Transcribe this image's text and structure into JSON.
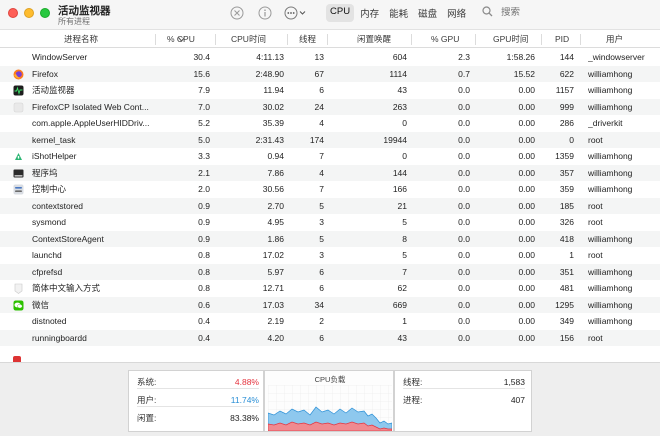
{
  "window": {
    "title": "活动监视器",
    "subtitle": "所有进程"
  },
  "toolbar": {
    "stop_icon": "stop-process-icon",
    "info_icon": "info-icon",
    "more_icon": "more-actions-icon",
    "tabs": [
      {
        "label": "CPU",
        "active": true
      },
      {
        "label": "内存",
        "active": false
      },
      {
        "label": "能耗",
        "active": false
      },
      {
        "label": "磁盘",
        "active": false
      },
      {
        "label": "网络",
        "active": false
      }
    ],
    "search_placeholder": "搜索"
  },
  "columns": [
    "进程名称",
    "% CPU",
    "CPU时间",
    "线程",
    "闲置唤醒",
    "% GPU",
    "GPU时间",
    "PID",
    "用户"
  ],
  "sorted_column": "% CPU",
  "processes": [
    {
      "name": "WindowServer",
      "cpu": "30.4",
      "cpu_time": "4:11.13",
      "threads": "13",
      "idle_wake": "604",
      "gpu": "2.3",
      "gpu_time": "1:58.26",
      "pid": "144",
      "user": "_windowserver",
      "icon": "none"
    },
    {
      "name": "Firefox",
      "cpu": "15.6",
      "cpu_time": "2:48.90",
      "threads": "67",
      "idle_wake": "1114",
      "gpu": "0.7",
      "gpu_time": "15.52",
      "pid": "622",
      "user": "williamhong",
      "icon": "firefox-icon"
    },
    {
      "name": "活动监视器",
      "cpu": "7.9",
      "cpu_time": "11.94",
      "threads": "6",
      "idle_wake": "43",
      "gpu": "0.0",
      "gpu_time": "0.00",
      "pid": "1157",
      "user": "williamhong",
      "icon": "activity-monitor-icon"
    },
    {
      "name": "FirefoxCP Isolated Web Cont...",
      "cpu": "7.0",
      "cpu_time": "30.02",
      "threads": "24",
      "idle_wake": "263",
      "gpu": "0.0",
      "gpu_time": "0.00",
      "pid": "999",
      "user": "williamhong",
      "icon": "generic-process-icon"
    },
    {
      "name": "com.apple.AppleUserHIDDriv...",
      "cpu": "5.2",
      "cpu_time": "35.39",
      "threads": "4",
      "idle_wake": "0",
      "gpu": "0.0",
      "gpu_time": "0.00",
      "pid": "286",
      "user": "_driverkit",
      "icon": "none"
    },
    {
      "name": "kernel_task",
      "cpu": "5.0",
      "cpu_time": "2:31.43",
      "threads": "174",
      "idle_wake": "19944",
      "gpu": "0.0",
      "gpu_time": "0.00",
      "pid": "0",
      "user": "root",
      "icon": "none"
    },
    {
      "name": "iShotHelper",
      "cpu": "3.3",
      "cpu_time": "0.94",
      "threads": "7",
      "idle_wake": "0",
      "gpu": "0.0",
      "gpu_time": "0.00",
      "pid": "1359",
      "user": "williamhong",
      "icon": "ishot-icon"
    },
    {
      "name": "程序坞",
      "cpu": "2.1",
      "cpu_time": "7.86",
      "threads": "4",
      "idle_wake": "144",
      "gpu": "0.0",
      "gpu_time": "0.00",
      "pid": "357",
      "user": "williamhong",
      "icon": "dock-icon"
    },
    {
      "name": "控制中心",
      "cpu": "2.0",
      "cpu_time": "30.56",
      "threads": "7",
      "idle_wake": "166",
      "gpu": "0.0",
      "gpu_time": "0.00",
      "pid": "359",
      "user": "williamhong",
      "icon": "control-center-icon"
    },
    {
      "name": "contextstored",
      "cpu": "0.9",
      "cpu_time": "2.70",
      "threads": "5",
      "idle_wake": "21",
      "gpu": "0.0",
      "gpu_time": "0.00",
      "pid": "185",
      "user": "root",
      "icon": "none"
    },
    {
      "name": "sysmond",
      "cpu": "0.9",
      "cpu_time": "4.95",
      "threads": "3",
      "idle_wake": "5",
      "gpu": "0.0",
      "gpu_time": "0.00",
      "pid": "326",
      "user": "root",
      "icon": "none"
    },
    {
      "name": "ContextStoreAgent",
      "cpu": "0.9",
      "cpu_time": "1.86",
      "threads": "5",
      "idle_wake": "8",
      "gpu": "0.0",
      "gpu_time": "0.00",
      "pid": "418",
      "user": "williamhong",
      "icon": "none"
    },
    {
      "name": "launchd",
      "cpu": "0.8",
      "cpu_time": "17.02",
      "threads": "3",
      "idle_wake": "5",
      "gpu": "0.0",
      "gpu_time": "0.00",
      "pid": "1",
      "user": "root",
      "icon": "none"
    },
    {
      "name": "cfprefsd",
      "cpu": "0.8",
      "cpu_time": "5.97",
      "threads": "6",
      "idle_wake": "7",
      "gpu": "0.0",
      "gpu_time": "0.00",
      "pid": "351",
      "user": "williamhong",
      "icon": "none"
    },
    {
      "name": "简体中文输入方式",
      "cpu": "0.8",
      "cpu_time": "12.71",
      "threads": "6",
      "idle_wake": "62",
      "gpu": "0.0",
      "gpu_time": "0.00",
      "pid": "481",
      "user": "williamhong",
      "icon": "input-method-icon"
    },
    {
      "name": "微信",
      "cpu": "0.6",
      "cpu_time": "17.03",
      "threads": "34",
      "idle_wake": "669",
      "gpu": "0.0",
      "gpu_time": "0.00",
      "pid": "1295",
      "user": "williamhong",
      "icon": "wechat-icon"
    },
    {
      "name": "distnoted",
      "cpu": "0.4",
      "cpu_time": "2.19",
      "threads": "2",
      "idle_wake": "1",
      "gpu": "0.0",
      "gpu_time": "0.00",
      "pid": "349",
      "user": "williamhong",
      "icon": "none"
    },
    {
      "name": "runningboardd",
      "cpu": "0.4",
      "cpu_time": "4.20",
      "threads": "6",
      "idle_wake": "43",
      "gpu": "0.0",
      "gpu_time": "0.00",
      "pid": "156",
      "user": "root",
      "icon": "none"
    }
  ],
  "summary": {
    "system_label": "系统:",
    "system_value": "4.88%",
    "user_label": "用户:",
    "user_value": "11.74%",
    "idle_label": "闲置:",
    "idle_value": "83.38%",
    "chart_title": "CPU负载",
    "threads_label": "线程:",
    "threads_value": "1,583",
    "processes_label": "进程:",
    "processes_value": "407"
  },
  "colors": {
    "system": "#e5343f",
    "user": "#2a8fd6",
    "user_fill": "#8ec8ee",
    "system_fill": "#f08a90"
  }
}
